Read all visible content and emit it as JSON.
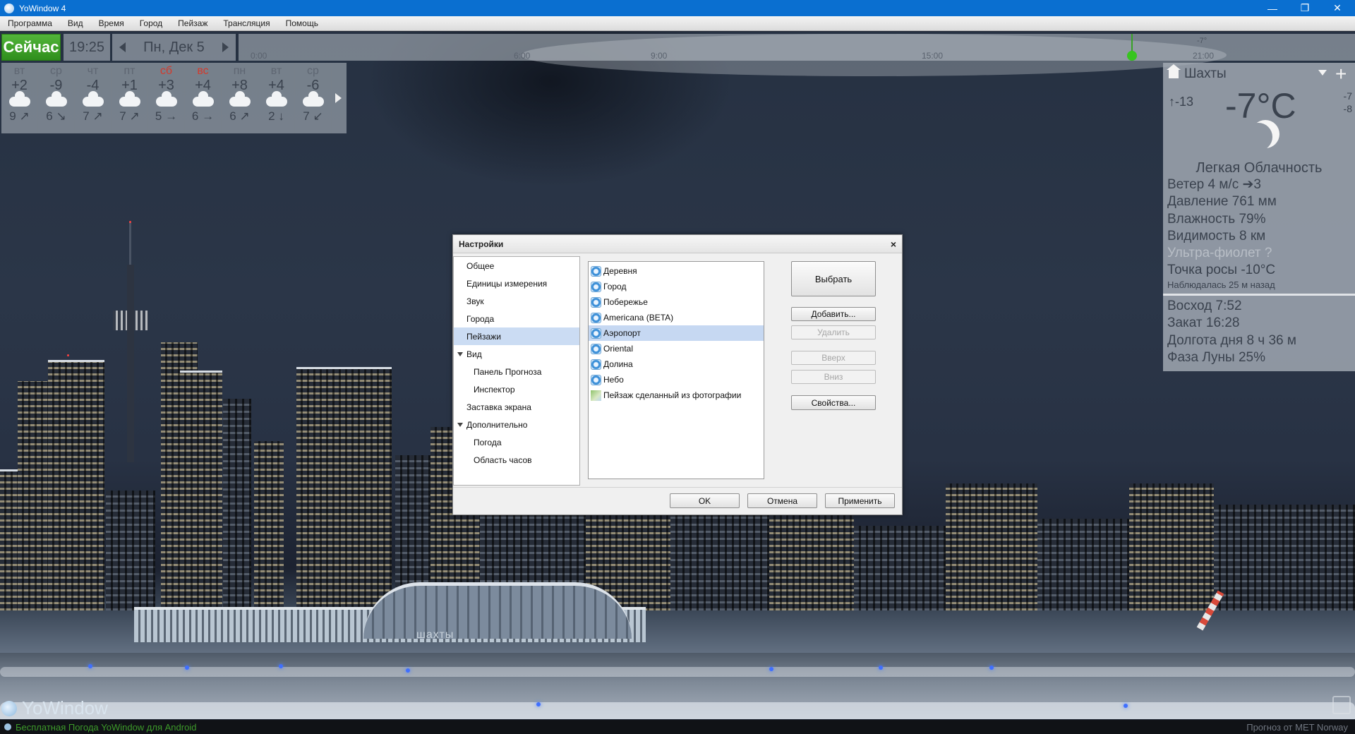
{
  "window": {
    "title": "YoWindow 4"
  },
  "menu": [
    "Программа",
    "Вид",
    "Время",
    "Город",
    "Пейзаж",
    "Трансляция",
    "Помощь"
  ],
  "timebar": {
    "now_label": "Сейчас",
    "time": "19:25",
    "date": "Пн, Дек 5",
    "ticks": [
      "0:00",
      "6:00",
      "9:00",
      "15:00",
      "21:00"
    ],
    "cursor_temp": "-7°"
  },
  "forecast": [
    {
      "day": "вт",
      "temp": "+2",
      "wind": "9 ↗",
      "weekend": false
    },
    {
      "day": "ср",
      "temp": "-9",
      "wind": "6 ↘",
      "weekend": false
    },
    {
      "day": "чт",
      "temp": "-4",
      "wind": "7 ↗",
      "weekend": false
    },
    {
      "day": "пт",
      "temp": "+1",
      "wind": "7 ↗",
      "weekend": false
    },
    {
      "day": "сб",
      "temp": "+3",
      "wind": "5 →",
      "weekend": true
    },
    {
      "day": "вс",
      "temp": "+4",
      "wind": "6 →",
      "weekend": true
    },
    {
      "day": "пн",
      "temp": "+8",
      "wind": "6 ↗",
      "weekend": false
    },
    {
      "day": "вт",
      "temp": "+4",
      "wind": "2 ↓",
      "weekend": false
    },
    {
      "day": "ср",
      "temp": "-6",
      "wind": "7 ↙",
      "weekend": false
    }
  ],
  "city": {
    "name": "Шахты",
    "feels_like": "-13",
    "temperature": "-7°C",
    "min": "-7",
    "max": "-8",
    "condition": "Легкая Облачность",
    "wind": "Ветер  4 м/с  ➔3",
    "pressure": "Давление  761 мм",
    "humidity": "Влажность  79%",
    "visibility": "Видимость  8 км",
    "uv": "Ультра-фиолет  ?",
    "dew_point": "Точка росы  -10°C",
    "observed": "Наблюдалась 25 м назад",
    "sunrise": "Восход  7:52",
    "sunset": "Закат  16:28",
    "day_length": "Долгота дня  8 ч 36 м",
    "moon_phase": "Фаза Луны  25%"
  },
  "scene": {
    "terminal_label": "шахты"
  },
  "logo": "YoWindow",
  "footer": {
    "promo": "Бесплатная Погода YoWindow для Android",
    "credit": "Прогноз от MET Norway"
  },
  "dialog": {
    "title": "Настройки",
    "close": "×",
    "nav": [
      {
        "label": "Общее",
        "indent": 0,
        "arrow": false,
        "selected": false
      },
      {
        "label": "Единицы измерения",
        "indent": 0,
        "arrow": false,
        "selected": false
      },
      {
        "label": "Звук",
        "indent": 0,
        "arrow": false,
        "selected": false
      },
      {
        "label": "Города",
        "indent": 0,
        "arrow": false,
        "selected": false
      },
      {
        "label": "Пейзажи",
        "indent": 0,
        "arrow": false,
        "selected": true
      },
      {
        "label": "Вид",
        "indent": 0,
        "arrow": true,
        "selected": false
      },
      {
        "label": "Панель Прогноза",
        "indent": 1,
        "arrow": false,
        "selected": false
      },
      {
        "label": "Инспектор",
        "indent": 1,
        "arrow": false,
        "selected": false
      },
      {
        "label": "Заставка экрана",
        "indent": 0,
        "arrow": false,
        "selected": false
      },
      {
        "label": "Дополнительно",
        "indent": 0,
        "arrow": true,
        "selected": false
      },
      {
        "label": "Погода",
        "indent": 1,
        "arrow": false,
        "selected": false
      },
      {
        "label": "Область часов",
        "indent": 1,
        "arrow": false,
        "selected": false
      }
    ],
    "landscapes": [
      {
        "label": "Деревня",
        "icon": "globe-icon",
        "selected": false
      },
      {
        "label": "Город",
        "icon": "globe-icon",
        "selected": false
      },
      {
        "label": "Побережье",
        "icon": "globe-icon",
        "selected": false
      },
      {
        "label": "Americana (BETA)",
        "icon": "globe-icon",
        "selected": false
      },
      {
        "label": "Аэропорт",
        "icon": "globe-icon",
        "selected": true
      },
      {
        "label": "Oriental",
        "icon": "globe-icon",
        "selected": false
      },
      {
        "label": "Долина",
        "icon": "globe-icon",
        "selected": false
      },
      {
        "label": "Небо",
        "icon": "globe-icon",
        "selected": false
      },
      {
        "label": "Пейзаж сделанный из фотографии",
        "icon": "photo-landscape-icon",
        "selected": false
      }
    ],
    "buttons": {
      "select": "Выбрать",
      "add": "Добавить...",
      "delete": "Удалить",
      "up": "Вверх",
      "down": "Вниз",
      "properties": "Свойства...",
      "ok": "OK",
      "cancel": "Отмена",
      "apply": "Применить"
    }
  }
}
